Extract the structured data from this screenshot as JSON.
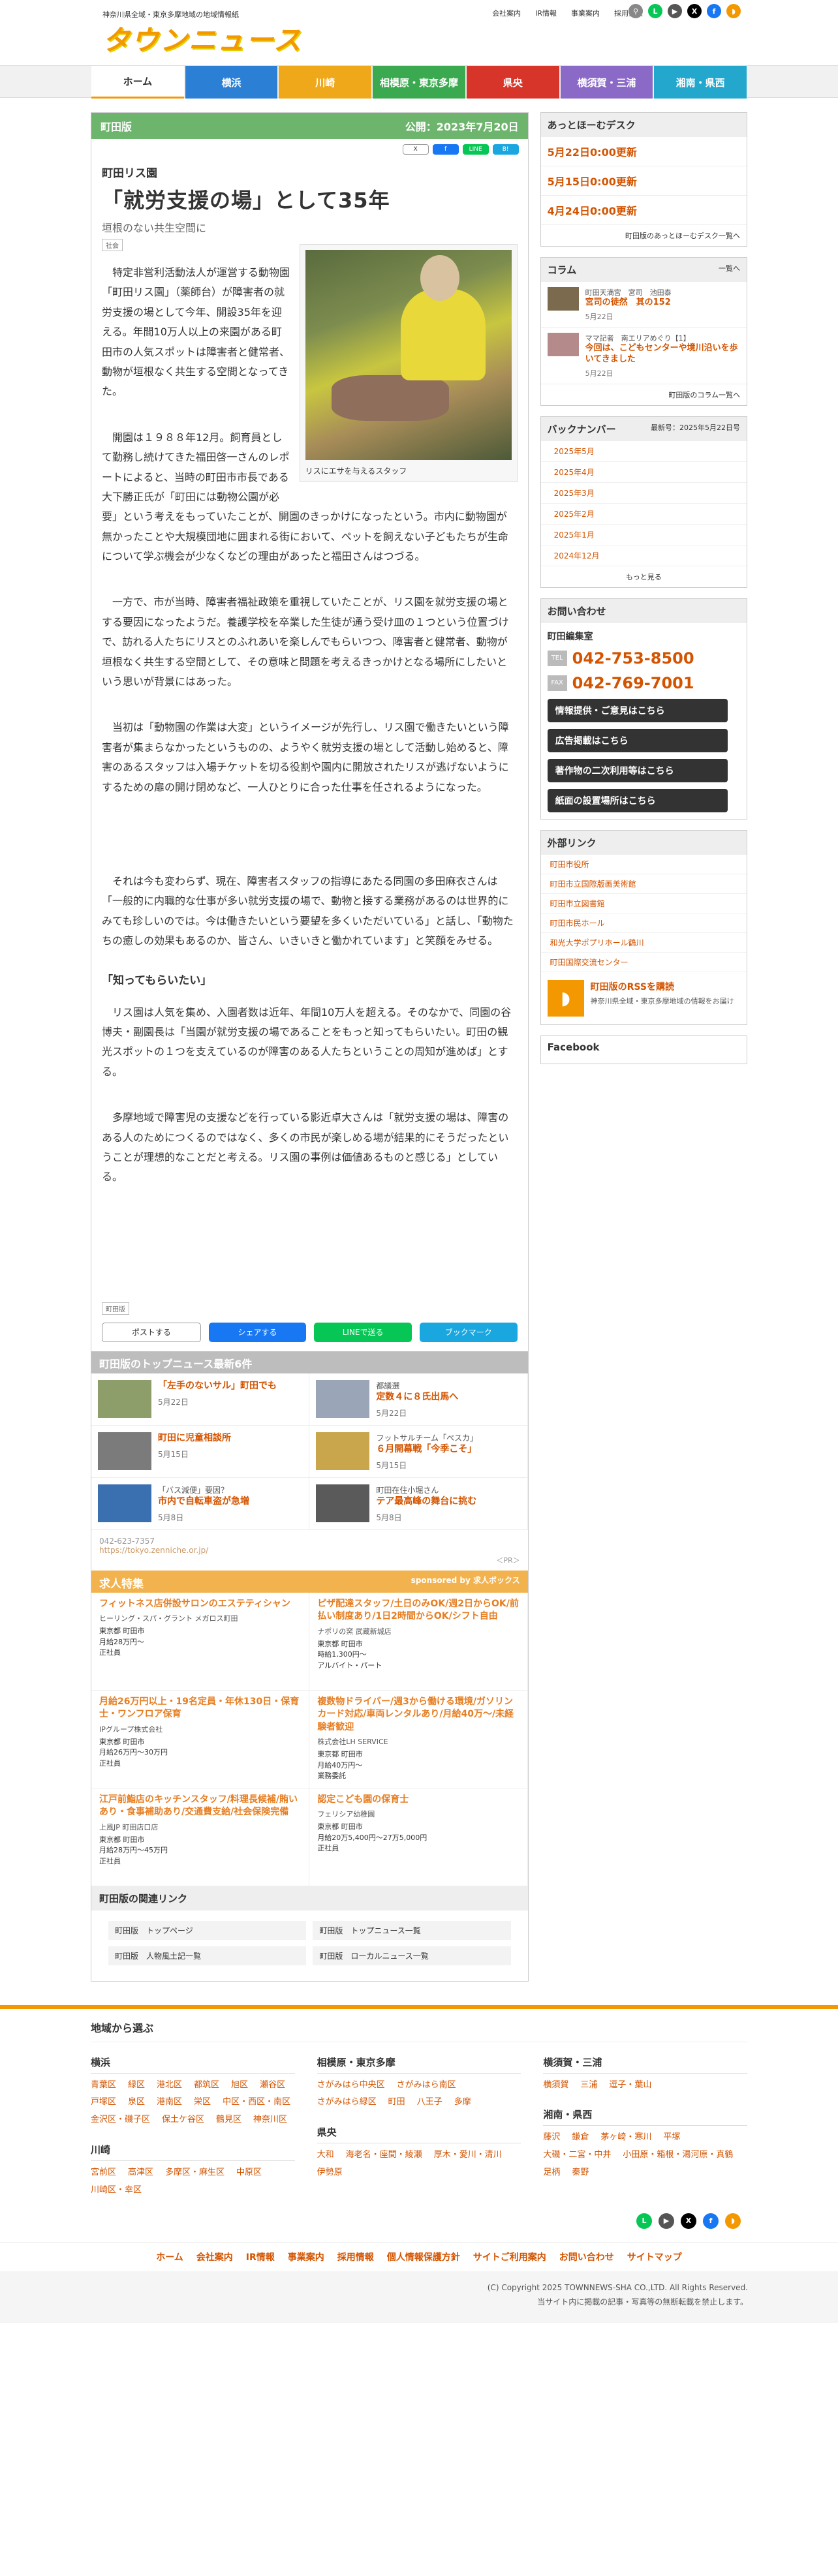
{
  "header": {
    "tagline": "神奈川県全域・東京多摩地域の地域情報紙",
    "logo": "タウンニュース",
    "toplinks": [
      "会社案内",
      "IR情報",
      "事業案内",
      "採用情報"
    ],
    "icons": [
      {
        "name": "search-icon",
        "color": "#888",
        "g": "⚲"
      },
      {
        "name": "line-icon",
        "color": "#06c755",
        "g": "L"
      },
      {
        "name": "youtube-icon",
        "color": "#555",
        "g": "▶"
      },
      {
        "name": "x-icon",
        "color": "#000",
        "g": "X"
      },
      {
        "name": "facebook-icon",
        "color": "#1877f2",
        "g": "f"
      },
      {
        "name": "rss-icon",
        "color": "#f39800",
        "g": "◗"
      }
    ]
  },
  "nav": [
    {
      "label": "ホーム",
      "color": "#ffffff"
    },
    {
      "label": "横浜",
      "color": "#2b7fd4"
    },
    {
      "label": "川崎",
      "color": "#f0a81b"
    },
    {
      "label": "相模原・東京多摩",
      "color": "#3aa94f"
    },
    {
      "label": "県央",
      "color": "#d8352a"
    },
    {
      "label": "横須賀・三浦",
      "color": "#8a69c7"
    },
    {
      "label": "湘南・県西",
      "color": "#23a7cc"
    }
  ],
  "article": {
    "edition": "町田版",
    "published": "公開：2023年7月20日",
    "share_top": [
      "X",
      "f",
      "LINE",
      "B!"
    ],
    "kicker": "町田リス園",
    "title": "「就労支援の場」として35年",
    "subtitle": "垣根のない共生空間に",
    "tag": "社会",
    "caption": "リスにエサを与えるスタッフ",
    "paras": [
      "特定非営利活動法人が運営する動物園「町田リス園」（薬師台）が障害者の就労支援の場として今年、開設35年を迎える。年間10万人以上の来園がある町田市の人気スポットは障害者と健常者、動物が垣根なく共生する空間となってきた。",
      "開園は１９８８年12月。飼育員として勤務し続けてきた福田啓一さんのレポートによると、当時の町田市市長である大下勝正氏が「町田には動物公園が必要」という考えをもっていたことが、開園のきっかけになったという。市内に動物園が無かったことや大規模団地に囲まれる街において、ペットを飼えない子どもたちが生命について学ぶ機会が少なくなどの理由があったと福田さんはつづる。",
      "一方で、市が当時、障害者福祉政策を重視していたことが、リス園を就労支援の場とする要因になったようだ。養護学校を卒業した生徒が通う受け皿の１つという位置づけで、訪れる人たちにリスとのふれあいを楽しんでもらいつつ、障害者と健常者、動物が垣根なく共生する空間として、その意味と問題を考えるきっかけとなる場所にしたいという思いが背景にはあった。",
      "当初は「動物園の作業は大変」というイメージが先行し、リス園で働きたいという障害者が集まらなかったというものの、ようやく就労支援の場として活動し始めると、障害のあるスタッフは入場チケットを切る役割や園内に開放されたリスが逃げないようにするための扉の開け閉めなど、一人ひとりに合った仕事を任されるようになった。",
      "それは今も変わらず、現在、障害者スタッフの指導にあたる同園の多田麻衣さんは「一般的に内職的な仕事が多い就労支援の場で、動物と接する業務があるのは世界的にみても珍しいのでは。今は働きたいという要望を多くいただいている」と話し、「動物たちの癒しの効果もあるのか、皆さん、いきいきと働かれています」と笑顔をみせる。"
    ],
    "section": "「知ってもらいたい」",
    "paras2": [
      "リス園は人気を集め、入園者数は近年、年間10万人を超える。そのなかで、同園の谷博夫・副園長は「当園が就労支援の場であることをもっと知ってもらいたい。町田の観光スポットの１つを支えているのが障害のある人たちということの周知が進めば」とする。",
      "多摩地域で障害児の支援などを行っている影近卓大さんは「就労支援の場は、障害のある人のためにつくるのではなく、多くの市民が楽しめる場が結果的にそうだったということが理想的なことだと考える。リス園の事例は価値あるものと感じる」としている。"
    ],
    "bottom_tag": "町田版",
    "share_bottom": [
      {
        "label": "ポストする",
        "color": "#ffffff"
      },
      {
        "label": "シェアする",
        "color": "#1877f2"
      },
      {
        "label": "LINEで送る",
        "color": "#06c755"
      },
      {
        "label": "ブックマーク",
        "color": "#1aa7e0"
      }
    ]
  },
  "topnews": {
    "heading": "町田版のトップニュース最新6件",
    "items": [
      {
        "small": "",
        "title": "「左手のないサル」町田でも",
        "date": "5月22日",
        "color": "#8e9e6b"
      },
      {
        "small": "都議選",
        "title": "定数４に８氏出馬へ",
        "date": "5月22日",
        "color": "#9aa6b7"
      },
      {
        "small": "",
        "title": "町田に児童相談所",
        "date": "5月15日",
        "color": "#7b7b7b"
      },
      {
        "small": "フットサルチーム「ペスカ」",
        "title": "６月開幕戦「今季こそ」",
        "date": "5月15日",
        "color": "#c9a64b"
      },
      {
        "small": "「バス減便」要因？",
        "title": "市内で自転車盗が急増",
        "date": "5月8日",
        "color": "#3a6fb0"
      },
      {
        "small": "町田在住小堀さん",
        "title": "テア最高峰の舞台に挑む",
        "date": "5月8日",
        "color": "#5a5a5a"
      }
    ]
  },
  "contact": {
    "tel": "042-623-7357",
    "url": "https://tokyo.zenniche.or.jp/",
    "pr": "＜PR＞"
  },
  "jobs": {
    "heading": "求人特集",
    "sponsor": "sponsored by 求人ボックス",
    "items": [
      {
        "title": "フィットネス店併設サロンのエステティシャン",
        "company": "ヒーリング・スパ・グラント メガロス町田",
        "lines": [
          "東京都 町田市",
          "月給28万円～",
          "正社員"
        ]
      },
      {
        "title": "ピザ配達スタッフ/土日のみOK/週2日からOK/前払い制度あり/1日2時間からOK/シフト自由",
        "company": "ナポリの窯 武蔵新城店",
        "lines": [
          "東京都 町田市",
          "時給1,300円～",
          "アルバイト・パート"
        ]
      },
      {
        "title": "月給26万円以上・19名定員・年休130日・保育士・ワンフロア保育",
        "company": "IPグループ株式会社",
        "lines": [
          "東京都 町田市",
          "月給26万円～30万円",
          "正社員"
        ]
      },
      {
        "title": "複数物ドライバー/週3から働ける環境/ガソリンカード対応/車両レンタルあり/月給40万～/未経験者歓迎",
        "company": "株式会社LH SERVICE",
        "lines": [
          "東京都 町田市",
          "月給40万円～",
          "業務委託"
        ]
      },
      {
        "title": "江戸前鮨店のキッチンスタッフ/料理長候補/賄いあり・食事補助あり/交通費支給/社会保険完備",
        "company": "上風JP 町田店口店",
        "lines": [
          "東京都 町田市",
          "月給28万円～45万円",
          "正社員"
        ]
      },
      {
        "title": "認定こども園の保育士",
        "company": "フェリシア幼稚園",
        "lines": [
          "東京都 町田市",
          "月給20万5,400円～27万5,000円",
          "正社員"
        ]
      }
    ]
  },
  "related": {
    "heading": "町田版の関連リンク",
    "links": [
      "町田版　トップページ",
      "町田版　トップニュース一覧",
      "町田版　人物風土記一覧",
      "町田版　ローカルニュース一覧"
    ]
  },
  "side": {
    "desk": {
      "heading": "あっとほーむデスク",
      "items": [
        "5月22日0:00更新",
        "5月15日0:00更新",
        "4月24日0:00更新"
      ],
      "more": "町田版のあっとほーむデスク一覧へ"
    },
    "column": {
      "heading": "コラム",
      "more_head": "一覧へ",
      "items": [
        {
          "small": "町田天満宮　宮司　池田泰",
          "title": "宮司の徒然　其の152",
          "date": "5月22日",
          "color": "#7b6a4d"
        },
        {
          "small": "ママ記者　南エリアめぐり【1】",
          "title": "今回は、こどもセンターや境川沿いを歩いてきました",
          "date": "5月22日",
          "color": "#b58a8a"
        }
      ],
      "more": "町田版のコラム一覧へ"
    },
    "backnumber": {
      "heading": "バックナンバー",
      "latest": "最新号：2025年5月22日号",
      "items": [
        "2025年5月",
        "2025年4月",
        "2025年3月",
        "2025年2月",
        "2025年1月",
        "2024年12月"
      ],
      "more": "もっと見る"
    },
    "inquiry": {
      "heading": "お問い合わせ",
      "office": "町田編集室",
      "tel_label": "TEL",
      "tel": "042-753-8500",
      "fax_label": "FAX",
      "fax": "042-769-7001",
      "buttons": [
        "情報提供・ご意見はこちら",
        "広告掲載はこちら",
        "著作物の二次利用等はこちら",
        "紙面の設置場所はこちら"
      ]
    },
    "external": {
      "heading": "外部リンク",
      "items": [
        "町田市役所",
        "町田市立国際版画美術館",
        "町田市立図書館",
        "町田市民ホール",
        "和光大学ポプリホール鶴川",
        "町田国際交流センター"
      ]
    },
    "rss": {
      "title": "町田版のRSSを購読",
      "sub": "神奈川県全域・東京多摩地域の情報をお届け"
    },
    "facebook": "Facebook"
  },
  "footer": {
    "heading": "地域から選ぶ",
    "groups": [
      [
        {
          "title": "横浜",
          "links": [
            "青葉区",
            "緑区",
            "港北区",
            "都筑区",
            "旭区",
            "瀬谷区",
            "戸塚区",
            "泉区",
            "港南区",
            "栄区",
            "中区・西区・南区",
            "金沢区・磯子区",
            "保土ケ谷区",
            "鶴見区",
            "神奈川区"
          ]
        },
        {
          "title": "川崎",
          "links": [
            "宮前区",
            "高津区",
            "多摩区・麻生区",
            "中原区",
            "川崎区・幸区"
          ]
        }
      ],
      [
        {
          "title": "相模原・東京多摩",
          "links": [
            "さがみはら中央区",
            "さがみはら南区",
            "さがみはら緑区",
            "町田",
            "八王子",
            "多摩"
          ]
        },
        {
          "title": "県央",
          "links": [
            "大和",
            "海老名・座間・綾瀬",
            "厚木・愛川・清川",
            "伊勢原"
          ]
        }
      ],
      [
        {
          "title": "横須賀・三浦",
          "links": [
            "横須賀",
            "三浦",
            "逗子・葉山"
          ]
        },
        {
          "title": "湘南・県西",
          "links": [
            "藤沢",
            "鎌倉",
            "茅ヶ崎・寒川",
            "平塚",
            "大磯・二宮・中井",
            "小田原・箱根・湯河原・真鶴",
            "足柄",
            "秦野"
          ]
        }
      ]
    ],
    "links": [
      "ホーム",
      "会社案内",
      "IR情報",
      "事業案内",
      "採用情報",
      "個人情報保護方針",
      "サイトご利用案内",
      "お問い合わせ",
      "サイトマップ"
    ],
    "copyright": "(C) Copyright 2025 TOWNNEWS-SHA CO.,LTD. All Rights Reserved.",
    "note": "当サイト内に掲載の記事・写真等の無断転載を禁止します。"
  }
}
